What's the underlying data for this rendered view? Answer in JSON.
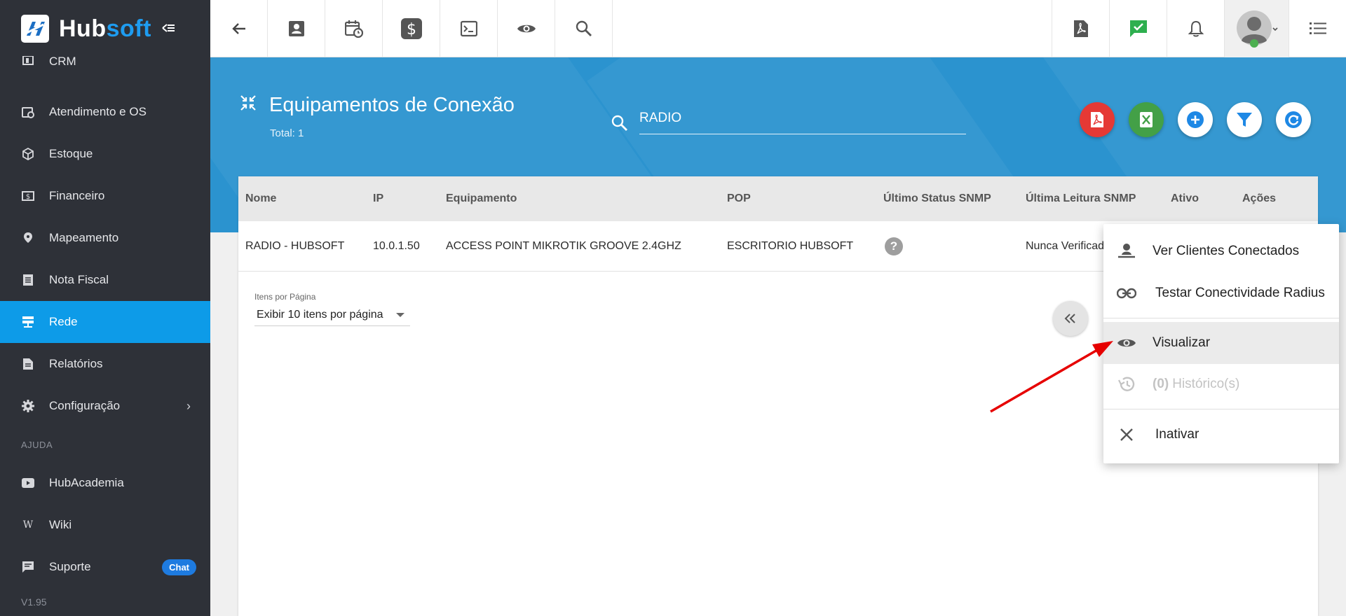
{
  "brand": {
    "name_a": "Hub",
    "name_b": "soft"
  },
  "sidebar": {
    "items": [
      {
        "label": "CRM"
      },
      {
        "label": "Atendimento e OS"
      },
      {
        "label": "Estoque"
      },
      {
        "label": "Financeiro"
      },
      {
        "label": "Mapeamento"
      },
      {
        "label": "Nota Fiscal"
      },
      {
        "label": "Rede"
      },
      {
        "label": "Relatórios"
      },
      {
        "label": "Configuração"
      }
    ],
    "help_section": "AJUDA",
    "help_items": [
      {
        "label": "HubAcademia"
      },
      {
        "label": "Wiki"
      },
      {
        "label": "Suporte",
        "badge": "Chat"
      }
    ],
    "version": "V1.95"
  },
  "page": {
    "title": "Equipamentos de Conexão",
    "total": "Total: 1",
    "search_value": "RADIO"
  },
  "table": {
    "headers": [
      "Nome",
      "IP",
      "Equipamento",
      "POP",
      "Último Status SNMP",
      "Última Leitura SNMP",
      "Ativo",
      "Ações"
    ],
    "rows": [
      {
        "nome": "RADIO - HUBSOFT",
        "ip": "10.0.1.50",
        "equipamento": "ACCESS POINT MIKROTIK GROOVE 2.4GHZ",
        "pop": "ESCRITORIO HUBSOFT",
        "status": "?",
        "leitura": "Nunca Verificad"
      }
    ]
  },
  "pager": {
    "label": "Itens por Página",
    "selected": "Exibir 10 itens por página"
  },
  "menu": {
    "items": [
      {
        "label": "Ver Clientes Conectados"
      },
      {
        "label": "Testar Conectividade Radius"
      },
      {
        "label": "Visualizar"
      },
      {
        "label": "Histórico(s)",
        "count": "(0)"
      },
      {
        "label": "Inativar"
      }
    ]
  },
  "colors": {
    "sidebar_bg": "#2e3138",
    "active": "#0d9be8",
    "hero": "#2b93cf",
    "pdf": "#e53935",
    "excel": "#43a047",
    "annotation_arrow": "#e60000"
  }
}
